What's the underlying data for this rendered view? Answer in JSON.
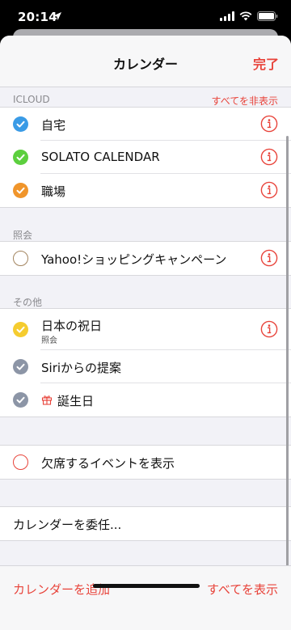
{
  "status_bar": {
    "time": "20:14"
  },
  "nav": {
    "title": "カレンダー",
    "done": "完了"
  },
  "sections": {
    "icloud": {
      "header": "ICLOUD",
      "action": "すべてを非表示"
    },
    "subscribed": {
      "header": "照会"
    },
    "other": {
      "header": "その他"
    }
  },
  "icloud_calendars": [
    {
      "name": "自宅",
      "color": "#3a9be6"
    },
    {
      "name": "SOLATO CALENDAR",
      "color": "#5ccf3e"
    },
    {
      "name": "職場",
      "color": "#f0952b"
    }
  ],
  "subscribed_calendars": [
    {
      "name": "Yahoo!ショッピングキャンペーン",
      "color": "#a2845e"
    }
  ],
  "other_calendars": [
    {
      "name": "日本の祝日",
      "subtitle": "照会",
      "color": "#f5cc2f"
    },
    {
      "name": "Siriからの提案",
      "color": "#8c95a6"
    },
    {
      "name": "誕生日",
      "color": "#8c95a6"
    }
  ],
  "declined": {
    "label": "欠席するイベントを表示"
  },
  "delegate": {
    "label": "カレンダーを委任..."
  },
  "bottom": {
    "add": "カレンダーを追加",
    "show_all": "すべてを表示"
  },
  "colors": {
    "accent": "#e8433a"
  }
}
